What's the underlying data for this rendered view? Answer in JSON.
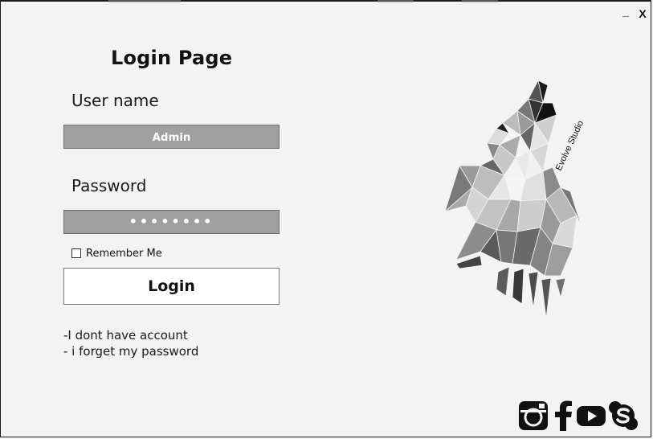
{
  "window": {
    "minimize_label": "_",
    "close_label": "X"
  },
  "login": {
    "title": "Login Page",
    "username_label": "User name",
    "username_value": "Admin",
    "password_label": "Password",
    "password_value": "••••••••",
    "remember_label": "Remember Me",
    "remember_checked": false,
    "login_button": "Login"
  },
  "links": {
    "no_account": "-I dont have account",
    "forgot_password": "- i forget my password"
  },
  "brand": {
    "logo_text": "Evolve Studio"
  },
  "social": [
    {
      "icon": "instagram-icon"
    },
    {
      "icon": "facebook-icon"
    },
    {
      "icon": "youtube-icon"
    },
    {
      "icon": "skype-icon"
    }
  ],
  "colors": {
    "background": "#f3f3f3",
    "field_fill": "#a0a0a0",
    "button_fill": "#ffffff",
    "text": "#111111"
  }
}
